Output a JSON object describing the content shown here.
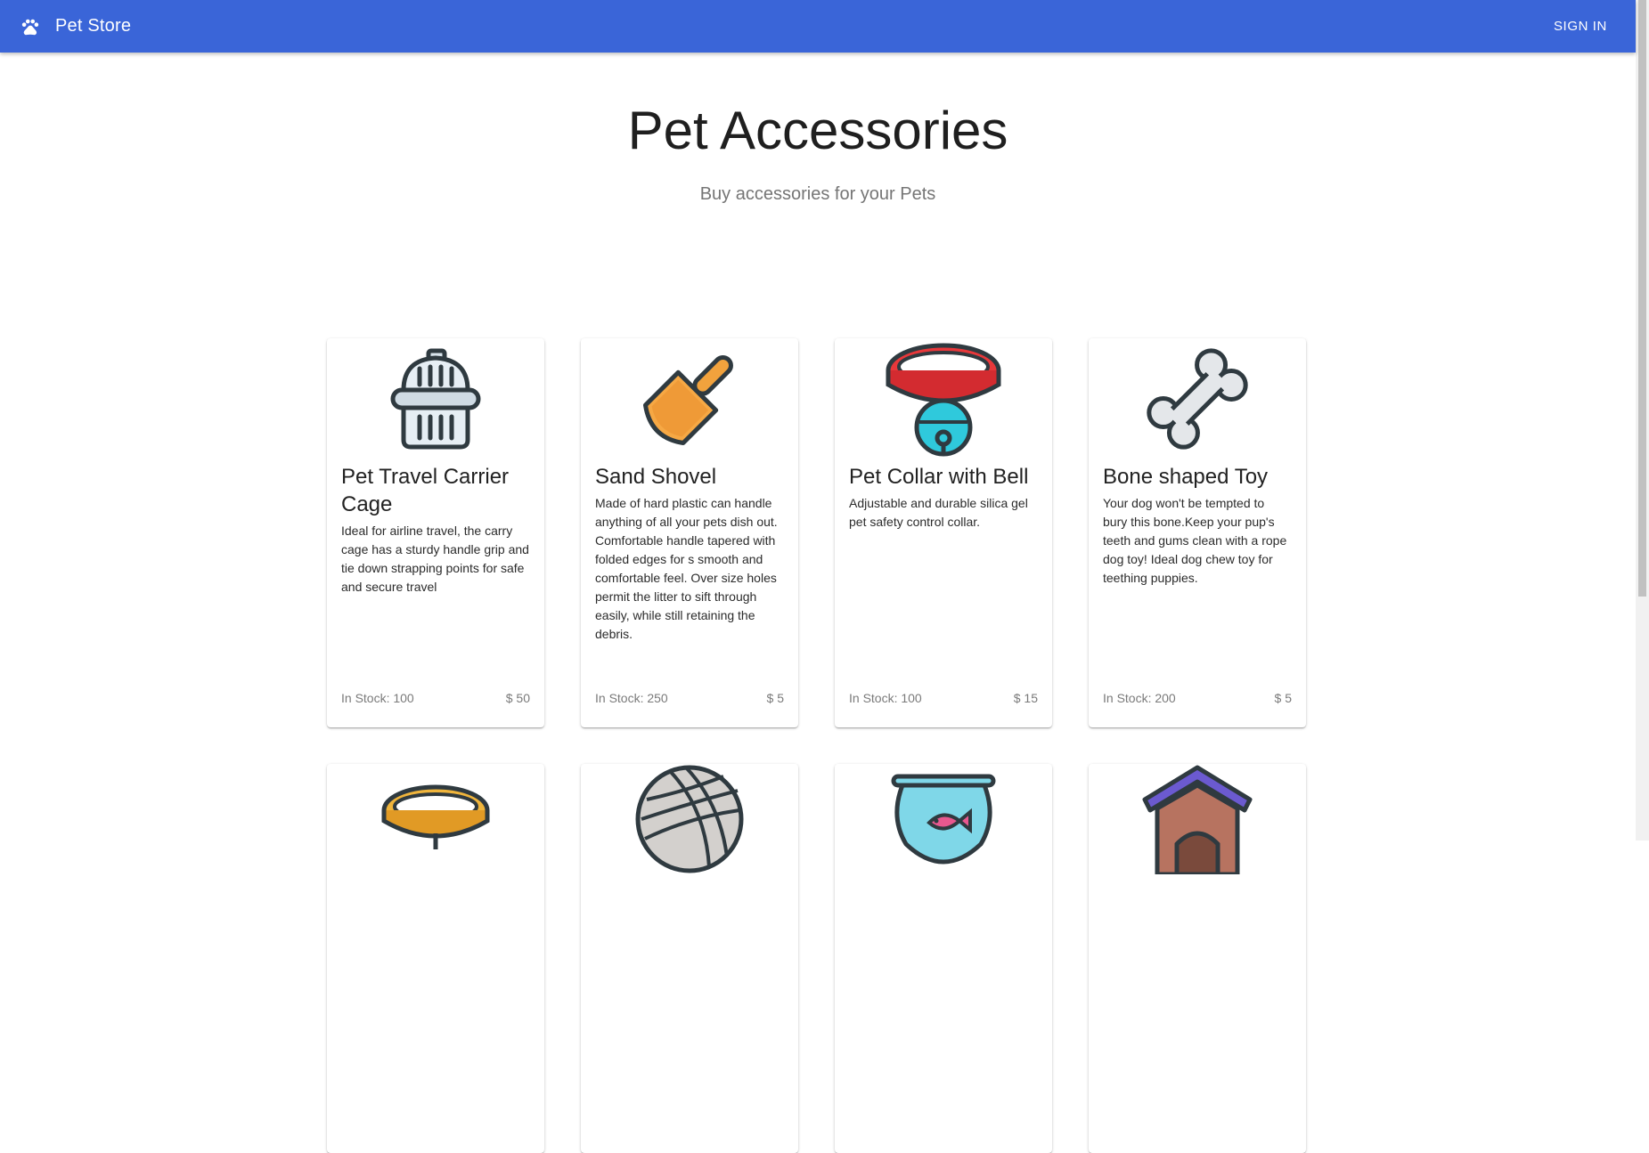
{
  "appbar": {
    "logo_icon": "paw-icon",
    "title": "Pet Store",
    "signin_label": "SIGN IN",
    "color": "#3a65d8"
  },
  "hero": {
    "title": "Pet Accessories",
    "subtitle": "Buy accessories for your Pets"
  },
  "products": [
    {
      "icon": "pet-carrier-icon",
      "name": "Pet Travel Carrier Cage",
      "description": "Ideal for airline travel, the carry cage has a sturdy handle grip and tie down strapping points for safe and secure travel",
      "stock": "In Stock: 100",
      "price": "$ 50"
    },
    {
      "icon": "sand-shovel-icon",
      "name": "Sand Shovel",
      "description": "Made of hard plastic can handle anything of all your pets dish out. Comfortable handle tapered with folded edges for s smooth and comfortable feel. Over size holes permit the litter to sift through easily, while still retaining the debris.",
      "stock": "In Stock: 250",
      "price": "$ 5"
    },
    {
      "icon": "collar-bell-icon",
      "name": "Pet Collar with Bell",
      "description": "Adjustable and durable silica gel pet safety control collar.",
      "stock": "In Stock: 100",
      "price": "$ 15"
    },
    {
      "icon": "bone-toy-icon",
      "name": "Bone shaped Toy",
      "description": "Your dog won't be tempted to bury this bone.Keep your pup's teeth and gums clean with a rope dog toy! Ideal dog chew toy for teething puppies.",
      "stock": "In Stock: 200",
      "price": "$ 5"
    },
    {
      "icon": "collar-icon"
    },
    {
      "icon": "yarn-ball-icon"
    },
    {
      "icon": "fish-bowl-icon"
    },
    {
      "icon": "dog-house-icon"
    }
  ]
}
